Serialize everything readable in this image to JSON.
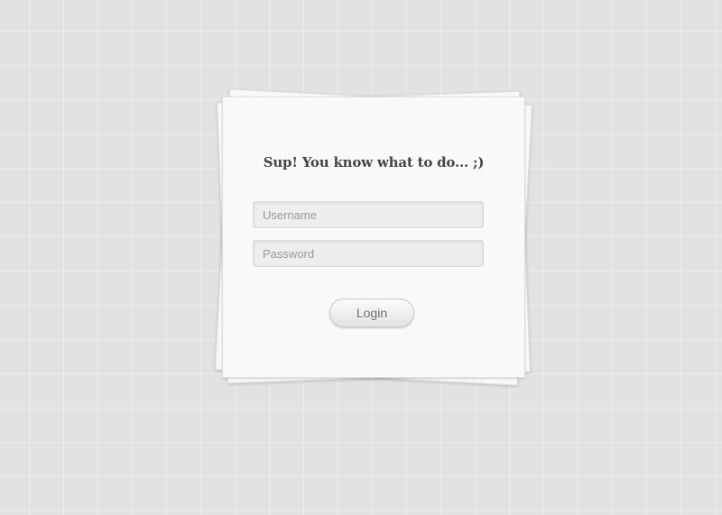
{
  "login": {
    "heading": "Sup! You know what to do... ;)",
    "username_placeholder": "Username",
    "password_placeholder": "Password",
    "submit_label": "Login"
  }
}
